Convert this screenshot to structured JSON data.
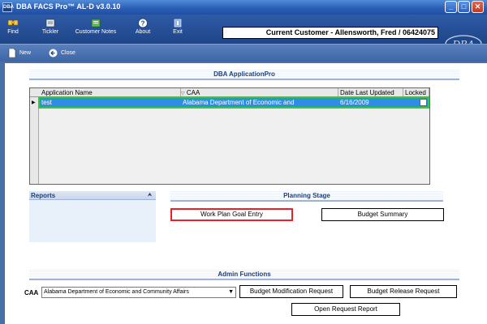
{
  "window": {
    "title": "DBA FACS Pro™ AL-D v3.0.10",
    "app_icon": "DBA"
  },
  "toolbar": {
    "items": [
      {
        "label": "Find",
        "icon": "find-icon"
      },
      {
        "label": "Tickler",
        "icon": "tickler-icon"
      },
      {
        "label": "Customer Notes",
        "icon": "notes-icon"
      },
      {
        "label": "About",
        "icon": "help-icon"
      },
      {
        "label": "Exit",
        "icon": "exit-icon"
      }
    ],
    "current_customer": "Current Customer - Allensworth, Fred / 06424075",
    "logo_text": "DBA"
  },
  "nav": {
    "new_label": "New",
    "close_label": "Close"
  },
  "application_section": {
    "title": "DBA ApplicationPro"
  },
  "grid": {
    "columns": [
      "Application Name",
      "CAA",
      "Date Last Updated",
      "Locked"
    ],
    "rows": [
      {
        "name": "test",
        "caa": "Alabama Department of Economic and",
        "date": "6/16/2009",
        "locked": false
      }
    ]
  },
  "reports": {
    "title": "Reports"
  },
  "planning": {
    "title": "Planning Stage",
    "work_plan_label": "Work Plan Goal Entry",
    "budget_summary_label": "Budget Summary"
  },
  "admin": {
    "title": "Admin Functions",
    "caa_label": "CAA",
    "caa_value": "Alabama Department of Economic and Community Affairs",
    "budget_mod_label": "Budget Modification Request",
    "budget_release_label": "Budget Release Request",
    "open_request_label": "Open Request Report"
  },
  "colors": {
    "titlebar": "#2a5db5",
    "selection": "#2f8de4",
    "highlight_border": "#e8202a",
    "row_outline": "#2bcf3a"
  }
}
